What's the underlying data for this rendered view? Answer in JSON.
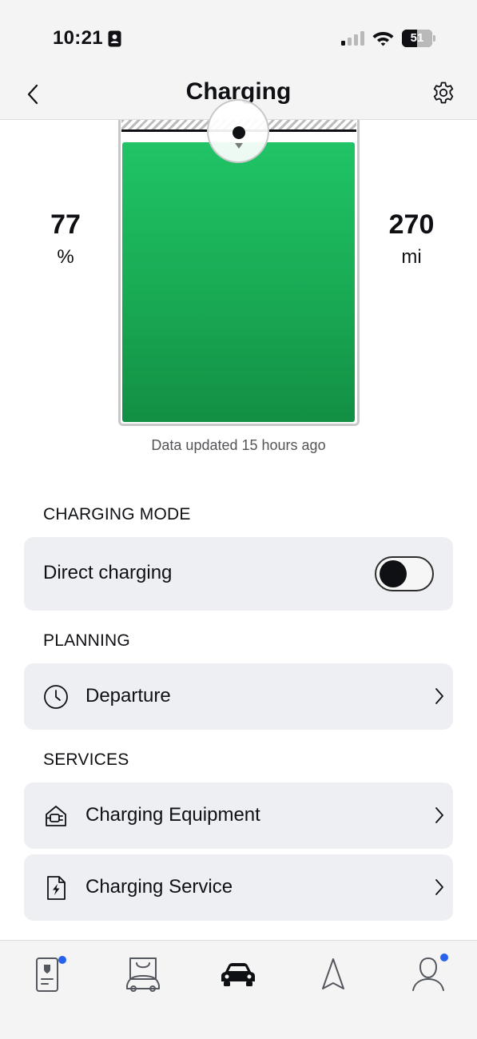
{
  "status_bar": {
    "time": "10:21",
    "battery_level": "51",
    "battery_fraction": 0.51,
    "icons": [
      "id-card-icon",
      "cellular-signal-icon",
      "wifi-icon",
      "battery-icon"
    ]
  },
  "header": {
    "title": "Charging",
    "back_icon": "chevron-left-icon",
    "settings_icon": "gear-icon"
  },
  "battery_status": {
    "state_of_charge": "77",
    "state_of_charge_unit": "%",
    "range": "270",
    "range_unit": "mi",
    "charge_fraction": 0.77,
    "fill_color": "#1fb95d",
    "updated_text": "Data updated 15 hours ago"
  },
  "charging_mode": {
    "section_title": "CHARGING MODE",
    "direct_charging_label": "Direct charging",
    "direct_charging_enabled": false
  },
  "planning": {
    "section_title": "PLANNING",
    "departure_label": "Departure",
    "departure_icon": "clock-icon"
  },
  "services": {
    "section_title": "SERVICES",
    "items": [
      {
        "label": "Charging Equipment",
        "icon": "charging-equipment-icon"
      },
      {
        "label": "Charging Service",
        "icon": "charging-service-document-icon"
      }
    ]
  },
  "tab_bar": {
    "accent_color": "#2762ec",
    "tabs": [
      {
        "icon": "phone-key-icon",
        "active": false,
        "badge": true
      },
      {
        "icon": "shop-icon",
        "active": false,
        "badge": false
      },
      {
        "icon": "car-icon",
        "active": true,
        "badge": false
      },
      {
        "icon": "navigation-arrow-icon",
        "active": false,
        "badge": false
      },
      {
        "icon": "profile-icon",
        "active": false,
        "badge": true
      }
    ]
  }
}
